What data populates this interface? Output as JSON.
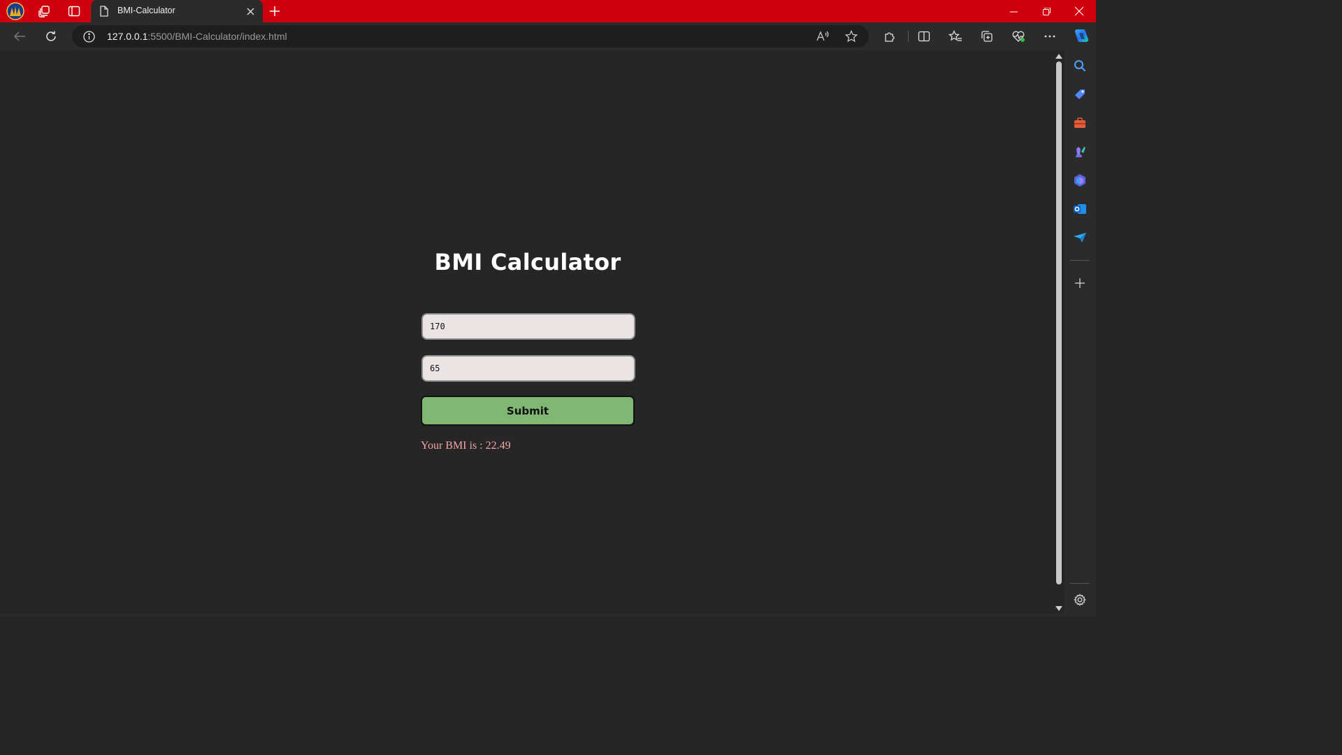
{
  "browser": {
    "tab": {
      "title": "BMI-Calculator"
    },
    "address": {
      "host": "127.0.0.1",
      "path": ":5500/BMI-Calculator/index.html"
    }
  },
  "page": {
    "title": "BMI Calculator",
    "height_field": {
      "value": "170"
    },
    "weight_field": {
      "value": "65"
    },
    "submit_label": "Submit",
    "result_text": "Your BMI is : 22.49"
  },
  "icons": {
    "titlebar": [
      "profile-avatar-icon",
      "workspaces-icon",
      "tab-actions-icon",
      "page-icon",
      "close-tab-icon",
      "new-tab-icon",
      "minimize-icon",
      "restore-icon",
      "close-window-icon"
    ],
    "toolbar": [
      "back-icon",
      "refresh-icon",
      "site-info-icon",
      "read-aloud-icon",
      "favorite-star-icon",
      "extensions-icon",
      "split-screen-icon",
      "favorites-icon",
      "collections-icon",
      "browser-essentials-icon",
      "more-icon",
      "copilot-icon"
    ],
    "sidebar": [
      "search-icon",
      "shopping-icon",
      "tools-icon",
      "games-icon",
      "copilot-sidebar-icon",
      "outlook-icon",
      "drop-icon",
      "add-icon",
      "settings-icon"
    ]
  },
  "colors": {
    "titlebar_bg": "#d0000e",
    "page_bg": "#262626",
    "submit_bg": "#80b873",
    "result_text": "#f2a6a6",
    "input_bg": "#ebe4e4"
  }
}
